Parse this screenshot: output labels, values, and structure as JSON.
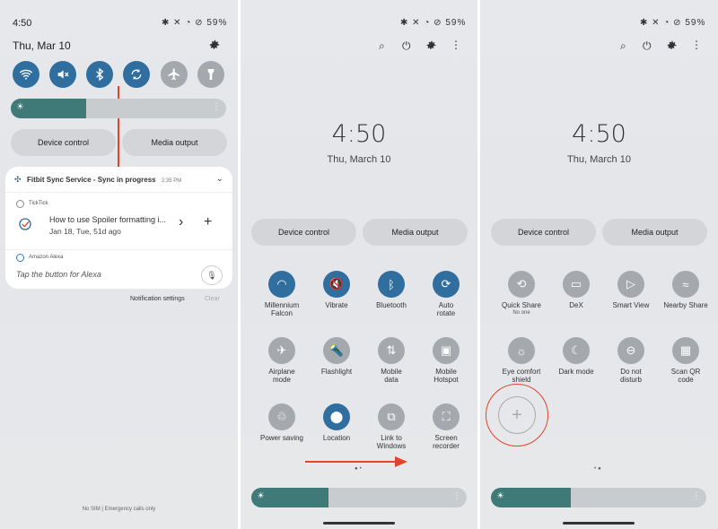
{
  "panel1": {
    "time": "4:50",
    "status_icons": "✱ ✕ ◔ ⊘",
    "battery": "59%",
    "date": "Thu, Mar 10",
    "notification_header": {
      "app": "Fitbit Sync Service",
      "text": "Sync in progress",
      "time": "2:35 PM"
    },
    "ticktick": {
      "app": "TickTick",
      "title": "How to use Spoiler formatting i...",
      "subtitle": "Jan 18, Tue, 51d ago"
    },
    "alexa": {
      "app": "Amazon Alexa",
      "text": "Tap the button for Alexa"
    },
    "notification_settings": "Notification settings",
    "clear": "Clear",
    "bottom_text": "No SIM | Emergency calls only",
    "device_control": "Device control",
    "media_output": "Media output"
  },
  "panel2": {
    "time": "4:50",
    "battery": "59%",
    "clock": "4:50",
    "date": "Thu, March 10",
    "device_control": "Device control",
    "media_output": "Media output",
    "tiles": [
      {
        "label": "Millennium",
        "label2": "Falcon",
        "icon": "wifi-icon",
        "on": true
      },
      {
        "label": "Vibrate",
        "label2": "",
        "icon": "vibrate-icon",
        "on": true
      },
      {
        "label": "Bluetooth",
        "label2": "",
        "icon": "bluetooth-icon",
        "on": true
      },
      {
        "label": "Auto",
        "label2": "rotate",
        "icon": "rotate-icon",
        "on": true
      },
      {
        "label": "Airplane",
        "label2": "mode",
        "icon": "airplane-icon",
        "on": false
      },
      {
        "label": "Flashlight",
        "label2": "",
        "icon": "flashlight-icon",
        "on": false
      },
      {
        "label": "Mobile",
        "label2": "data",
        "icon": "mobile-data-icon",
        "on": false
      },
      {
        "label": "Mobile",
        "label2": "Hotspot",
        "icon": "hotspot-icon",
        "on": false
      },
      {
        "label": "Power saving",
        "label2": "",
        "icon": "power-saving-icon",
        "on": false
      },
      {
        "label": "Location",
        "label2": "",
        "icon": "location-icon",
        "on": true
      },
      {
        "label": "Link to",
        "label2": "Windows",
        "icon": "link-windows-icon",
        "on": false
      },
      {
        "label": "Screen",
        "label2": "recorder",
        "icon": "screen-recorder-icon",
        "on": false
      }
    ]
  },
  "panel3": {
    "time": "4:50",
    "battery": "59%",
    "clock": "4:50",
    "date": "Thu, March 10",
    "device_control": "Device control",
    "media_output": "Media output",
    "tiles": [
      {
        "label": "Quick Share",
        "label2": "",
        "sub": "No one",
        "icon": "quick-share-icon"
      },
      {
        "label": "DeX",
        "label2": "",
        "sub": "",
        "icon": "dex-icon"
      },
      {
        "label": "Smart View",
        "label2": "",
        "sub": "",
        "icon": "smart-view-icon"
      },
      {
        "label": "Nearby Share",
        "label2": "",
        "sub": "",
        "icon": "nearby-share-icon"
      },
      {
        "label": "Eye comfort",
        "label2": "shield",
        "sub": "",
        "icon": "eye-comfort-icon"
      },
      {
        "label": "Dark mode",
        "label2": "",
        "sub": "",
        "icon": "dark-mode-icon"
      },
      {
        "label": "Do not",
        "label2": "disturb",
        "sub": "",
        "icon": "dnd-icon"
      },
      {
        "label": "Scan QR",
        "label2": "code",
        "sub": "",
        "icon": "qr-icon"
      }
    ]
  },
  "brightness": {
    "panel1": 0.35,
    "panel2": 0.36,
    "panel3": 0.37
  },
  "colors": {
    "accent": "#2f6e9f",
    "off": "#a5a9ae",
    "arrow": "#e0452c",
    "brightness_fill": "#3f7a78"
  }
}
